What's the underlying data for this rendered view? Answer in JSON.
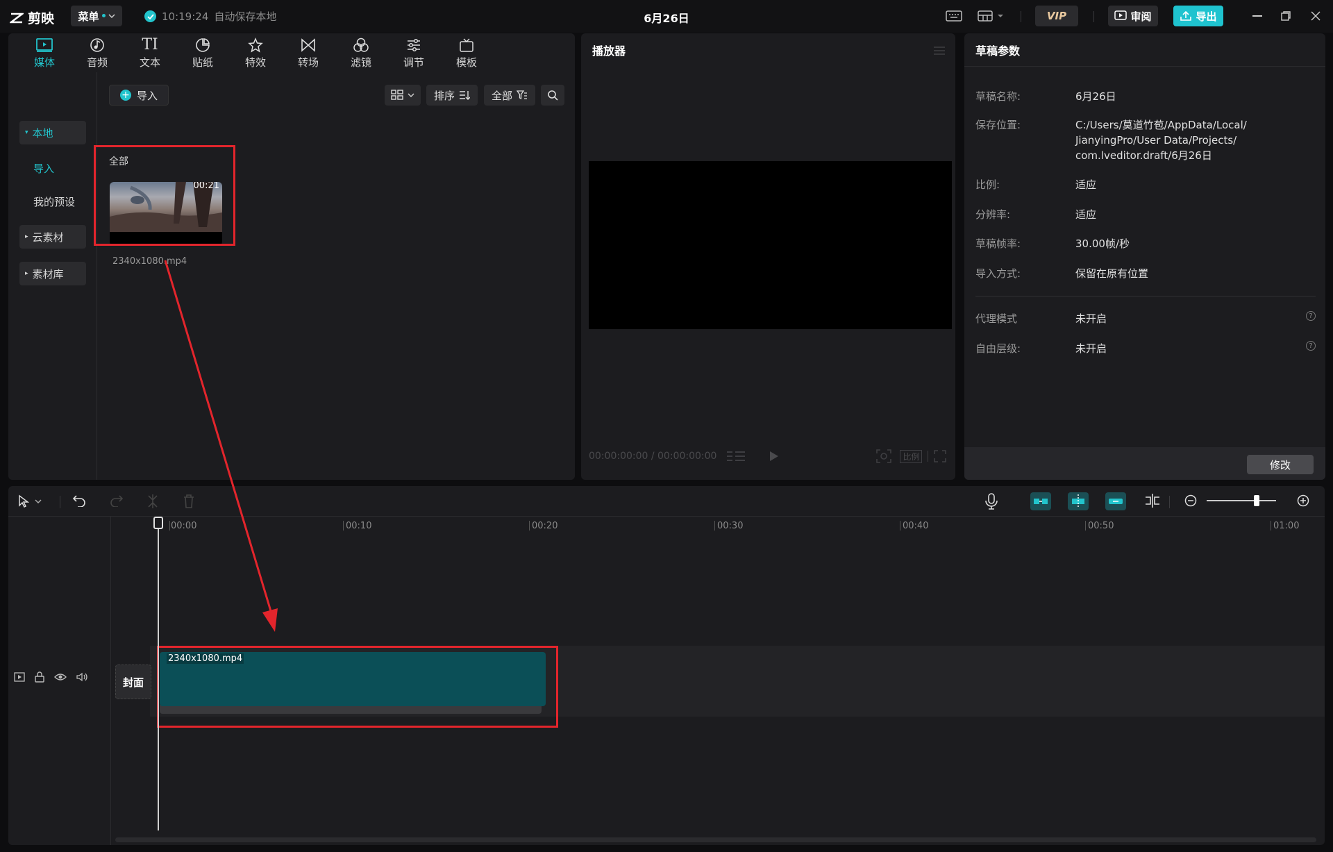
{
  "app": {
    "name": "剪映",
    "menu_label": "菜单",
    "save_time": "10:19:24",
    "save_status": "自动保存本地",
    "doc_title": "6月26日"
  },
  "topbar": {
    "vip_label": "VIP",
    "review_label": "审阅",
    "export_label": "导出"
  },
  "media_tabs": [
    {
      "label": "媒体",
      "icon": "media-icon",
      "active": true
    },
    {
      "label": "音频",
      "icon": "audio-icon"
    },
    {
      "label": "文本",
      "icon": "text-icon"
    },
    {
      "label": "贴纸",
      "icon": "sticker-icon"
    },
    {
      "label": "特效",
      "icon": "effects-icon"
    },
    {
      "label": "转场",
      "icon": "transition-icon"
    },
    {
      "label": "滤镜",
      "icon": "filter-icon"
    },
    {
      "label": "调节",
      "icon": "adjust-icon"
    },
    {
      "label": "模板",
      "icon": "template-icon"
    }
  ],
  "media_sidebar": {
    "local": "本地",
    "import": "导入",
    "my_presets": "我的预设",
    "cloud": "云素材",
    "library": "素材库"
  },
  "media": {
    "import_label": "导入",
    "sort_label": "排序",
    "filter_label": "全部",
    "all_label": "全部",
    "clip": {
      "duration": "00:21",
      "name": "2340x1080.mp4"
    }
  },
  "player": {
    "title": "播放器",
    "timecode": "00:00:00:00 / 00:00:00:00",
    "ratio_label": "比例"
  },
  "props": {
    "title": "草稿参数",
    "rows": [
      {
        "label": "草稿名称:",
        "value": "6月26日"
      },
      {
        "label": "保存位置:",
        "value": "C:/Users/莫道竹苞/AppData/Local/\nJianyingPro/User Data/Projects/\ncom.lveditor.draft/6月26日"
      },
      {
        "label": "比例:",
        "value": "适应"
      },
      {
        "label": "分辨率:",
        "value": "适应"
      },
      {
        "label": "草稿帧率:",
        "value": "30.00帧/秒"
      },
      {
        "label": "导入方式:",
        "value": "保留在原有位置"
      },
      {
        "label": "代理模式",
        "value": "未开启"
      },
      {
        "label": "自由层级:",
        "value": "未开启"
      }
    ],
    "modify_label": "修改"
  },
  "timeline": {
    "ticks": [
      "00:00",
      "00:10",
      "00:20",
      "00:30",
      "00:40",
      "00:50",
      "01:00"
    ],
    "cover_label": "封面",
    "clip_label": "2340x1080.mp4"
  },
  "colors": {
    "accent": "#22c4cc",
    "highlight": "#e3252c",
    "clip": "#0b4f57"
  }
}
